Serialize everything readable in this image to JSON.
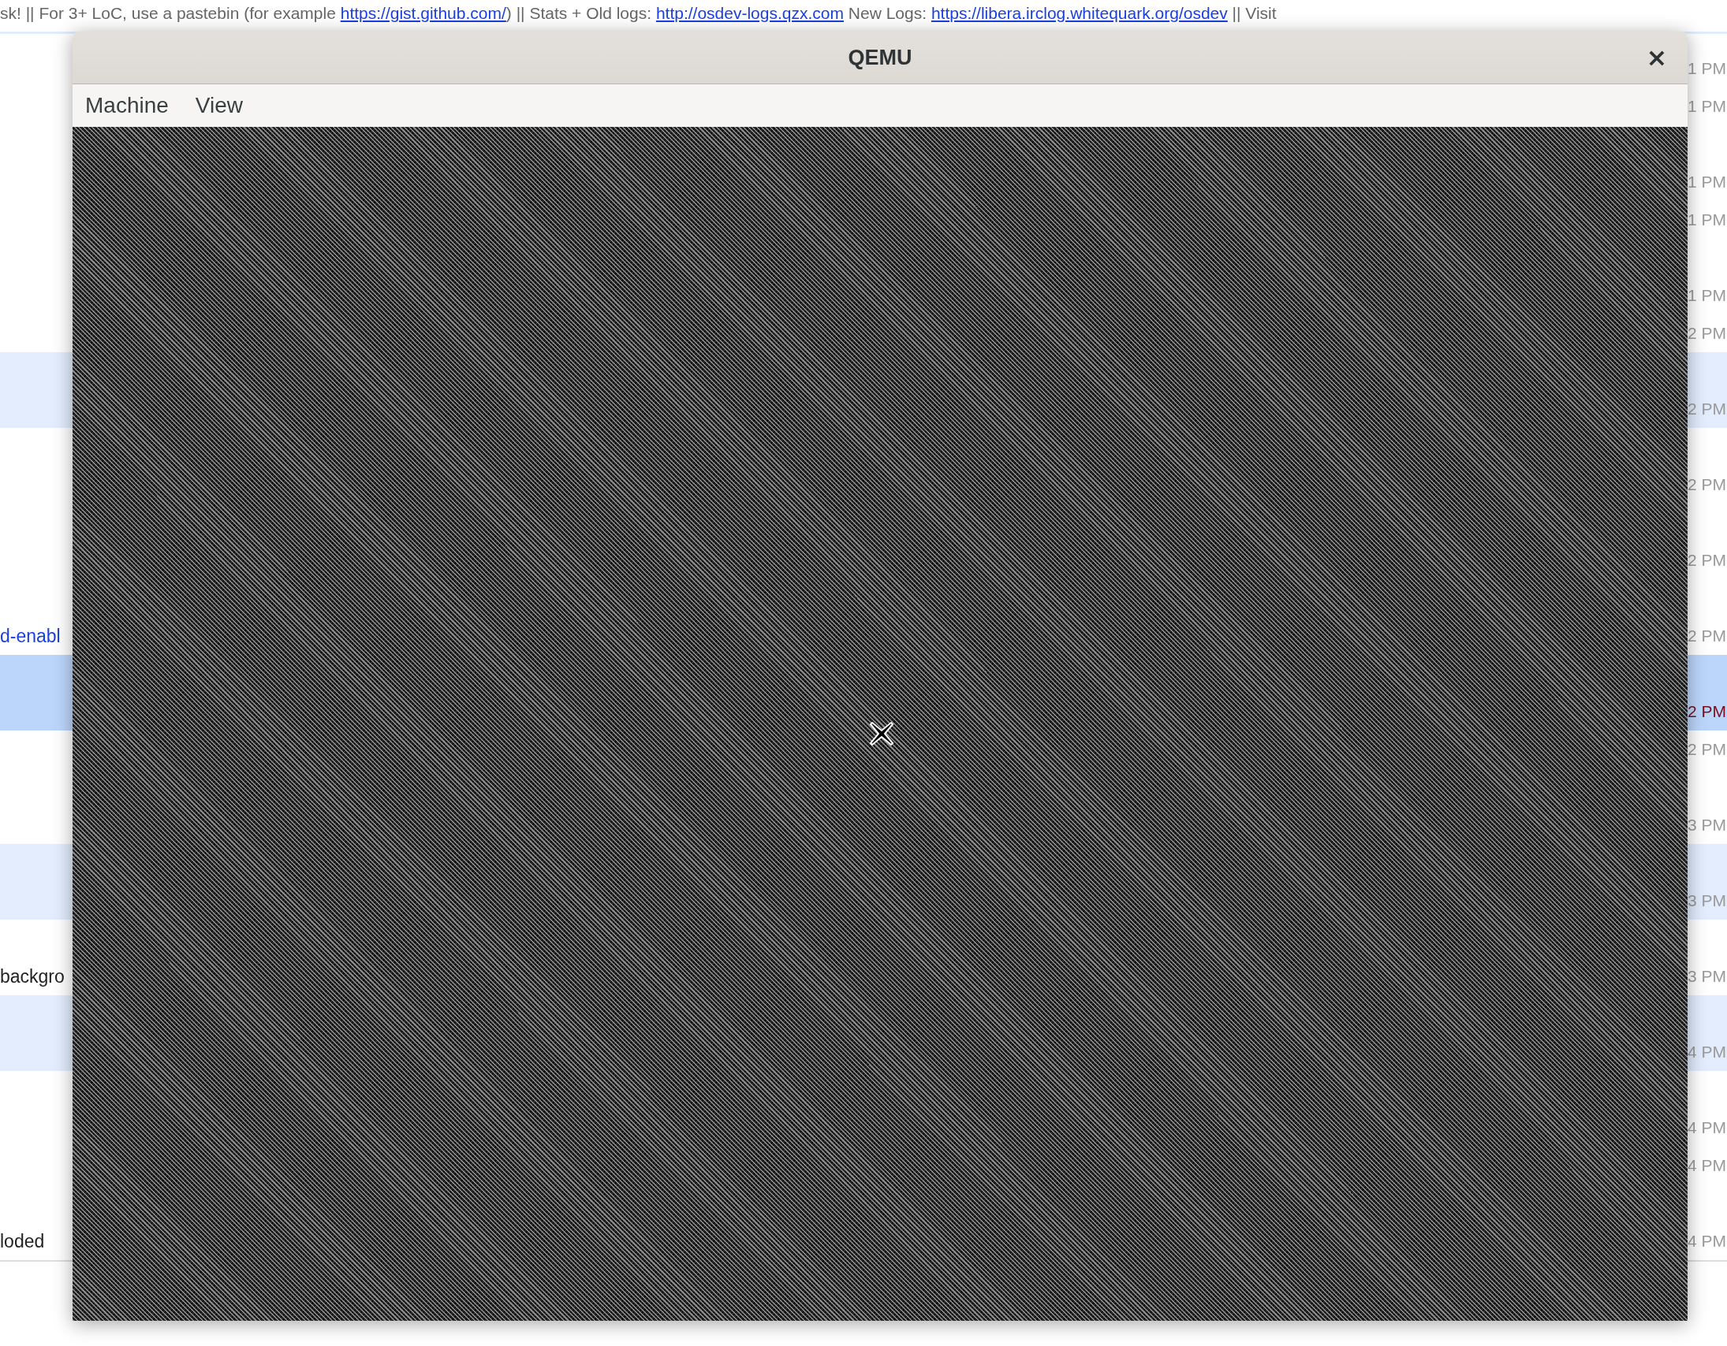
{
  "topic": {
    "parts": [
      {
        "kind": "text",
        "text": "sk! || For 3+ LoC, use a pastebin (for example "
      },
      {
        "kind": "link",
        "text": "https://gist.github.com/"
      },
      {
        "kind": "text",
        "text": ") || Stats + Old logs: "
      },
      {
        "kind": "link",
        "text": "http://osdev-logs.qzx.com"
      },
      {
        "kind": "text",
        "text": " New Logs: "
      },
      {
        "kind": "link",
        "text": "https://libera.irclog.whitequark.org/osdev"
      },
      {
        "kind": "text",
        "text": " || Visit"
      }
    ]
  },
  "messages": [
    {
      "kind": "single",
      "time": "1 PM",
      "highlighted": false,
      "mentioned": false
    },
    {
      "kind": "single",
      "time": "1 PM",
      "highlighted": false,
      "mentioned": false
    },
    {
      "kind": "double",
      "time": "1 PM",
      "highlighted": false,
      "mentioned": false
    },
    {
      "kind": "single",
      "time": "1 PM",
      "highlighted": false,
      "mentioned": false
    },
    {
      "kind": "double",
      "time": "1 PM",
      "highlighted": false,
      "mentioned": false
    },
    {
      "kind": "single",
      "time": "2 PM",
      "highlighted": false,
      "mentioned": false
    },
    {
      "kind": "double",
      "time": "2 PM",
      "highlighted": true,
      "mentioned": false
    },
    {
      "kind": "double",
      "time": "2 PM",
      "highlighted": false,
      "mentioned": false
    },
    {
      "kind": "double",
      "time": "2 PM",
      "highlighted": false,
      "mentioned": false
    },
    {
      "kind": "double",
      "time": "2 PM",
      "highlighted": false,
      "mentioned": false,
      "content": {
        "kind": "link",
        "text": "d-enabl"
      }
    },
    {
      "kind": "double",
      "time": "2 PM",
      "highlighted": true,
      "mentioned": true
    },
    {
      "kind": "single",
      "time": "2 PM",
      "highlighted": false,
      "mentioned": false
    },
    {
      "kind": "double",
      "time": "3 PM",
      "highlighted": false,
      "mentioned": false
    },
    {
      "kind": "double",
      "time": "3 PM",
      "highlighted": true,
      "mentioned": false
    },
    {
      "kind": "double",
      "time": "3 PM",
      "highlighted": false,
      "mentioned": false,
      "content": {
        "kind": "text",
        "text": "backgro"
      }
    },
    {
      "kind": "double",
      "time": "4 PM",
      "highlighted": true,
      "mentioned": false
    },
    {
      "kind": "double",
      "time": "4 PM",
      "highlighted": false,
      "mentioned": false
    },
    {
      "kind": "single",
      "time": "4 PM",
      "highlighted": false,
      "mentioned": false
    },
    {
      "kind": "double",
      "time": "4 PM",
      "highlighted": false,
      "mentioned": false,
      "content": {
        "kind": "text",
        "text": "loded"
      }
    }
  ],
  "window": {
    "title": "QEMU",
    "close": "×",
    "menu": [
      "Machine",
      "View"
    ]
  }
}
